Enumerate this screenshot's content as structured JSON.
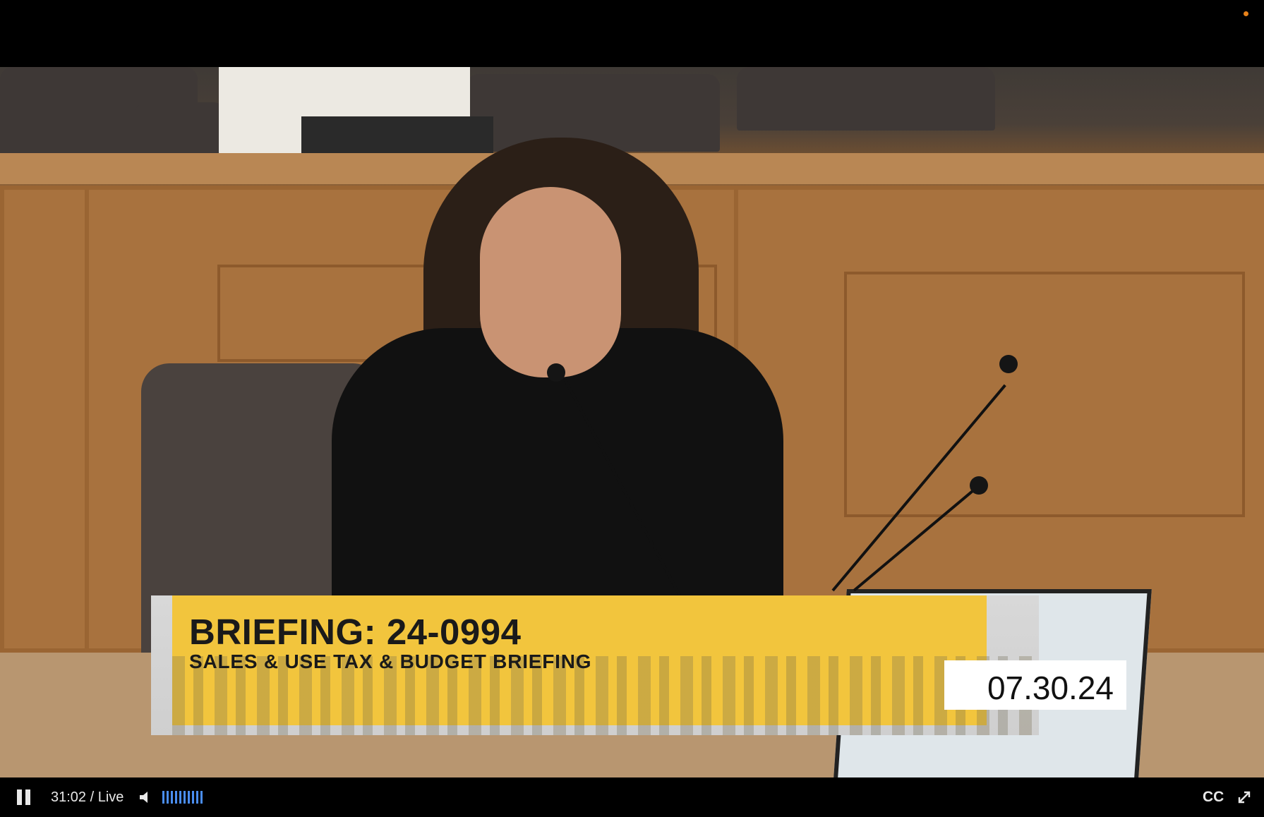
{
  "video": {
    "lower_third_title": "BRIEFING: 24-0994",
    "lower_third_subtitle": "SALES & USE TAX & BUDGET BRIEFING",
    "date": "07.30.24"
  },
  "controls": {
    "time": "31:02 / Live",
    "cc_label": "CC",
    "volume_level_fraction": 1.0,
    "accent_color": "#4a8df0",
    "icons": [
      "pause-icon",
      "volume-icon",
      "expand-icon"
    ]
  }
}
